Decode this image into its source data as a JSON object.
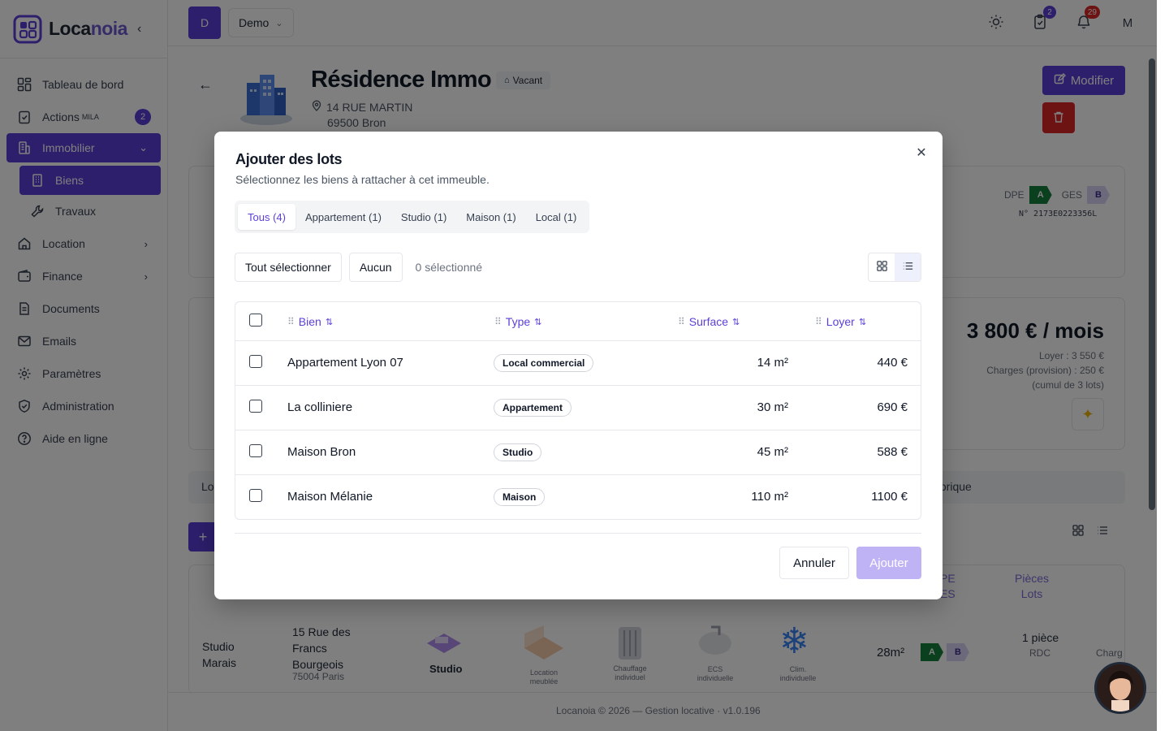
{
  "brand": {
    "name_part1": "Loca",
    "name_part2": "noia"
  },
  "sidebar": {
    "items": [
      {
        "label": "Tableau de bord"
      },
      {
        "label": "Actions",
        "sup": "MILA",
        "badge": "2"
      },
      {
        "label": "Immobilier"
      },
      {
        "label": "Biens"
      },
      {
        "label": "Travaux"
      },
      {
        "label": "Location"
      },
      {
        "label": "Finance"
      },
      {
        "label": "Documents"
      },
      {
        "label": "Emails"
      },
      {
        "label": "Paramètres"
      },
      {
        "label": "Administration"
      },
      {
        "label": "Aide en ligne"
      }
    ]
  },
  "topbar": {
    "workspace_initial": "D",
    "workspace_name": "Demo",
    "tasks_count": "2",
    "notif_count": "29",
    "user_initial": "M"
  },
  "property": {
    "title": "Résidence Immo",
    "status": "Vacant",
    "address_line1": "14 RUE MARTIN",
    "address_line2": "69500 Bron",
    "edit_label": "Modifier",
    "dpe_label": "DPE",
    "dpe_grade": "A",
    "ges_label": "GES",
    "ges_grade": "B",
    "dpe_number": "N° 2173E0223356L",
    "rent_total": "3 800 € / mois",
    "rent_detail": "Loyer : 3 550 €",
    "charges_detail": "Charges (provision) : 250 €",
    "cumul": "(cumul de 3 lots)",
    "tab_left": "Lo",
    "tab_right": "torique"
  },
  "background_table": {
    "col_dpe": "PE\nES",
    "col_pieces": "Pièces",
    "col_lots": "Lots",
    "row_name": "Studio Marais",
    "row_address": "15 Rue des Francs Bourgeois",
    "row_zip": "75004 Paris",
    "row_type": "Studio",
    "feat1": "Location meublée",
    "feat2": "Chauffage individuel",
    "feat3": "ECS individuelle",
    "feat4": "Clim. individuelle",
    "row_surface": "28m²",
    "row_dpe": "A",
    "row_ges": "B",
    "row_pieces": "1 pièce",
    "row_floor": "RDC",
    "row_charges": "Charg"
  },
  "footer": {
    "text": "Locanoia © 2026 — Gestion locative · v1.0.196"
  },
  "modal": {
    "title": "Ajouter des lots",
    "subtitle": "Sélectionnez les biens à rattacher à cet immeuble.",
    "tabs": [
      {
        "label": "Tous (4)",
        "active": true
      },
      {
        "label": "Appartement (1)"
      },
      {
        "label": "Studio (1)"
      },
      {
        "label": "Maison (1)"
      },
      {
        "label": "Local (1)"
      }
    ],
    "select_all": "Tout sélectionner",
    "select_none": "Aucun",
    "selected_count": "0 sélectionné",
    "columns": {
      "bien": "Bien",
      "type": "Type",
      "surface": "Surface",
      "loyer": "Loyer"
    },
    "rows": [
      {
        "name": "Appartement Lyon 07",
        "type": "Local commercial",
        "surface": "14 m²",
        "rent": "440 €"
      },
      {
        "name": "La colliniere",
        "type": "Appartement",
        "surface": "30 m²",
        "rent": "690 €"
      },
      {
        "name": "Maison Bron",
        "type": "Studio",
        "surface": "45 m²",
        "rent": "588 €"
      },
      {
        "name": "Maison Mélanie",
        "type": "Maison",
        "surface": "110 m²",
        "rent": "1100 €"
      }
    ],
    "cancel": "Annuler",
    "submit": "Ajouter"
  },
  "colors": {
    "primary": "#5b3fd9",
    "danger": "#dc2626",
    "dpe_a": "#15803d",
    "ges_b": "#d9d3f7"
  }
}
